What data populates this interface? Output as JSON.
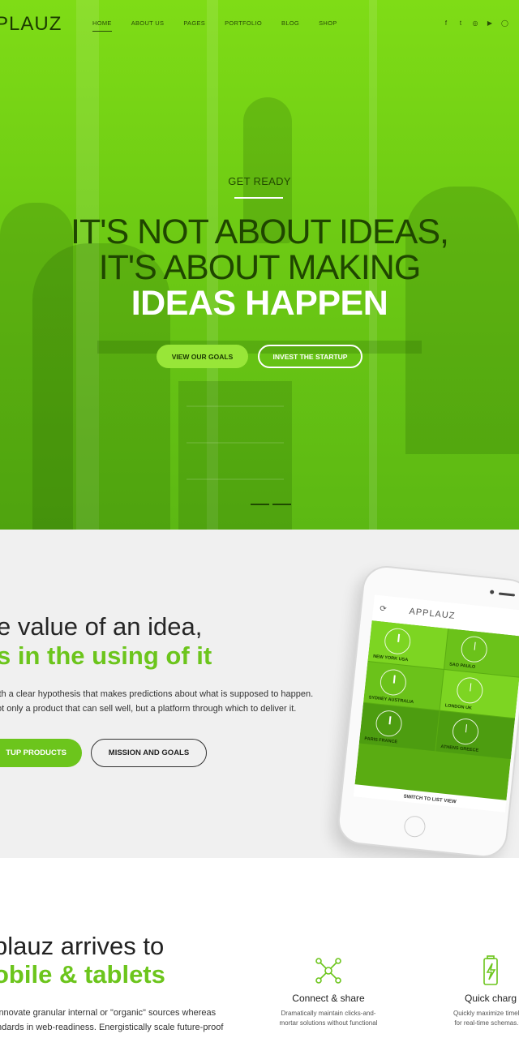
{
  "nav": {
    "logo": "PLAUZ",
    "menu": [
      "HOME",
      "ABOUT US",
      "PAGES",
      "PORTFOLIO",
      "BLOG",
      "SHOP"
    ],
    "active": "HOME",
    "social": [
      "f",
      "t",
      "◎",
      "▶",
      "◯"
    ]
  },
  "hero": {
    "eyebrow": "GET READY",
    "line1": "IT'S NOT ABOUT IDEAS,",
    "line2": "IT'S ABOUT MAKING",
    "line3": "IDEAS HAPPEN",
    "btn_primary": "VIEW OUR GOALS",
    "btn_secondary": "INVEST THE STARTUP",
    "accent": "#7fdc16"
  },
  "intro": {
    "title_light": "e value of an idea,",
    "title_bold": "s in the using of it",
    "para_line1": "ith a clear hypothesis that makes predictions about what is supposed to happen.",
    "para_line2": "ot only a product that can sell well, but a platform through which to deliver it.",
    "btn_primary": "TUP PRODUCTS",
    "btn_secondary": "MISSION AND GOALS",
    "accent": "#6cc51c"
  },
  "phone": {
    "app_title": "APPLAUZ",
    "cities": [
      "NEW YORK",
      "SAO PAULO",
      "SYDNEY",
      "LONDON",
      "PARIS",
      "ATHENS"
    ],
    "cities_full": [
      "NEW YORK USA",
      "SAO PAULO",
      "SYDNEY AUSTRALIA",
      "LONDON UK",
      "PARIS FRANCE",
      "ATHENS GREECE"
    ],
    "switch_label": "SWITCH TO LIST VIEW"
  },
  "mobile": {
    "title_light": "plauz arrives to",
    "title_bold": "obile & tablets",
    "para_line1": "innovate granular internal or \"organic\" sources whereas",
    "para_line2": "ndards in web-readiness. Energistically scale future-proof"
  },
  "features": [
    {
      "title": "Connect & share",
      "line1": "Dramatically maintain clicks-and-",
      "line2": "mortar solutions without functional",
      "icon": "network-icon"
    },
    {
      "title": "Quick charg",
      "line1": "Quickly maximize timely d",
      "line2": "for real-time schemas.Co",
      "icon": "battery-charge-icon"
    }
  ]
}
